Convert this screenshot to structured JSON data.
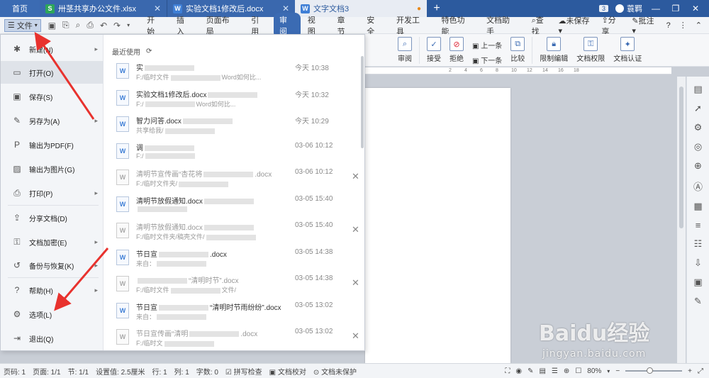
{
  "titlebar": {
    "tabs": [
      {
        "label": "首页"
      },
      {
        "label": "卅茎共享办公文件.xlsx"
      },
      {
        "label": "实验文档1修改后.docx"
      },
      {
        "label": "文字文档3"
      }
    ],
    "badge": "3",
    "user": "蓑羁"
  },
  "menubar": {
    "file_label": "文件",
    "menus": [
      "开始",
      "插入",
      "页面布局",
      "引用",
      "审阅",
      "视图",
      "章节",
      "安全",
      "开发工具",
      "特色功能",
      "文档助手"
    ],
    "search_label": "查找",
    "unsaved": "未保存",
    "share": "分享",
    "annotate": "批注"
  },
  "ribbon": {
    "review": "审阅",
    "accept": "接受",
    "reject": "拒绝",
    "prev": "上一条",
    "next": "下一条",
    "compare": "比较",
    "restrict": "限制编辑",
    "permission": "文档权限",
    "certify": "文档认证"
  },
  "ruler": [
    "2",
    "4",
    "6",
    "8",
    "10",
    "12",
    "14",
    "16",
    "18"
  ],
  "filemenu": {
    "items": [
      {
        "label": "新建(N)"
      },
      {
        "label": "打开(O)"
      },
      {
        "label": "保存(S)"
      },
      {
        "label": "另存为(A)"
      },
      {
        "label": "输出为PDF(F)"
      },
      {
        "label": "输出为图片(G)"
      },
      {
        "label": "打印(P)"
      },
      {
        "label": "分享文档(D)"
      },
      {
        "label": "文档加密(E)"
      },
      {
        "label": "备份与恢复(K)"
      },
      {
        "label": "帮助(H)"
      },
      {
        "label": "选项(L)"
      },
      {
        "label": "退出(Q)"
      }
    ]
  },
  "recent": {
    "heading": "最近使用",
    "files": [
      {
        "name": "实",
        "name_tail": "",
        "path": "F:/临时文件",
        "path_tail": "Word如何比...",
        "time": "今天 10:38",
        "gray": false,
        "remove": ""
      },
      {
        "name": "实验文档1修改后.docx",
        "name_tail": "",
        "path": "F:/",
        "path_tail": "Word如何比...",
        "time": "今天 10:32",
        "gray": false,
        "remove": ""
      },
      {
        "name": "智力问答.docx",
        "name_tail": "",
        "path": "共享给我/",
        "path_tail": "",
        "time": "今天 10:29",
        "gray": false,
        "remove": ""
      },
      {
        "name": "调",
        "name_tail": "",
        "path": "F:/",
        "path_tail": "",
        "time": "03-06 10:12",
        "gray": false,
        "remove": ""
      },
      {
        "name": "清明节宣传画“杏花将",
        "name_tail": ".docx",
        "path": "F:/临时文件夹/",
        "path_tail": "",
        "time": "03-06 10:12",
        "gray": true,
        "remove": "✕"
      },
      {
        "name": "清明节放假通知.docx",
        "name_tail": "",
        "path": "",
        "path_tail": "",
        "time": "03-05 15:40",
        "gray": false,
        "remove": ""
      },
      {
        "name": "清明节放假通知.docx",
        "name_tail": "",
        "path": "F:/临时文件夹/稿壳文件/",
        "path_tail": "",
        "time": "03-05 15:40",
        "gray": true,
        "remove": "✕"
      },
      {
        "name": "节日宣",
        "name_tail": ".docx",
        "path": "来自：",
        "path_tail": "",
        "time": "03-05 14:38",
        "gray": false,
        "remove": ""
      },
      {
        "name": "",
        "name_tail": "“清明时节”.docx",
        "path": "F:/临时文件",
        "path_tail": "文件/",
        "time": "03-05 14:38",
        "gray": true,
        "remove": "✕"
      },
      {
        "name": "节日宣",
        "name_tail": "“清明时节雨纷纷”.docx",
        "path": "来自：",
        "path_tail": "",
        "time": "03-05 13:02",
        "gray": false,
        "remove": ""
      },
      {
        "name": "节日宣传画“清明",
        "name_tail": ".docx",
        "path": "F:/临时文",
        "path_tail": "",
        "time": "03-05 13:02",
        "gray": true,
        "remove": "✕"
      }
    ]
  },
  "statusbar": {
    "page_no": "页码: 1",
    "pages": "页面: 1/1",
    "section": "节: 1/1",
    "setting": "设置值: 2.5厘米",
    "row": "行: 1",
    "col": "列: 1",
    "words": "字数: 0",
    "spell": "拼写检查",
    "proof": "文档校对",
    "protect": "文档未保护",
    "zoom": "80%"
  },
  "watermark": {
    "logo": "Baidu经验",
    "url": "jingyan.baidu.com"
  }
}
